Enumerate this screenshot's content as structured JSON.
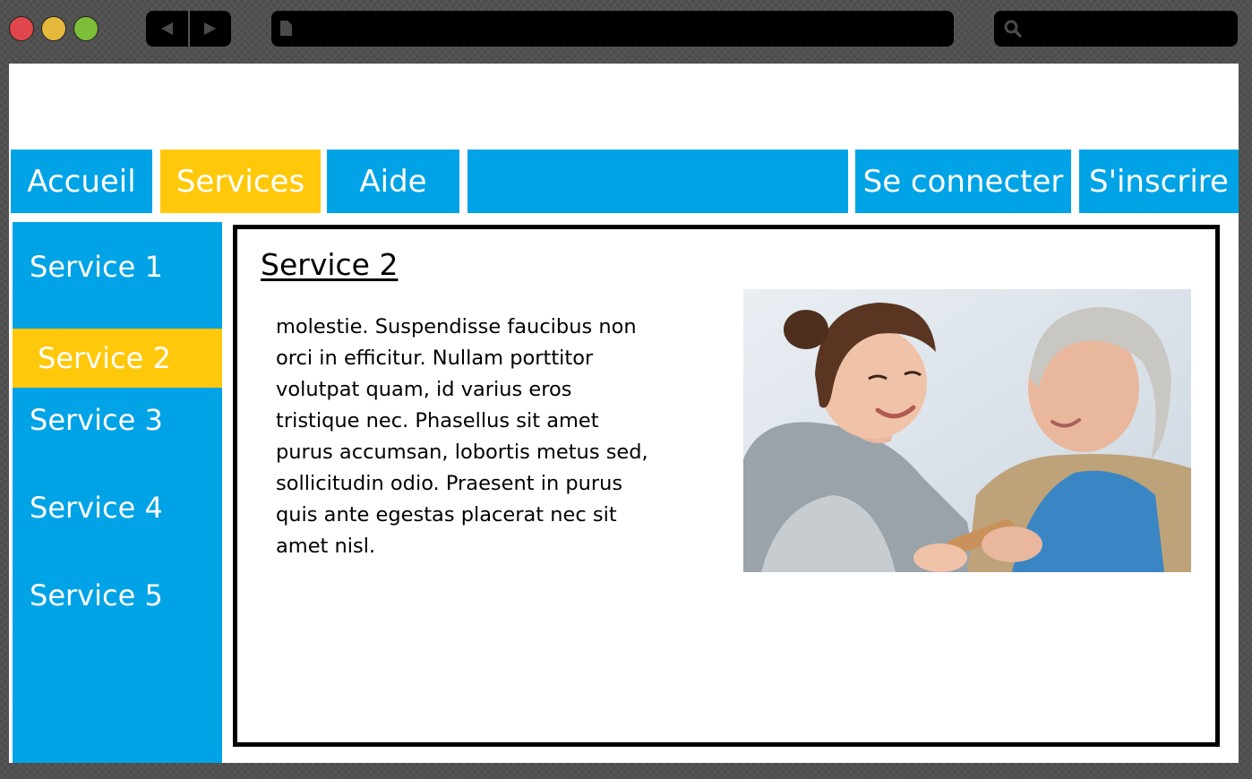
{
  "browser": {
    "url": "",
    "search": ""
  },
  "topnav": {
    "items": [
      {
        "label": "Accueil",
        "active": false
      },
      {
        "label": "Services",
        "active": true
      },
      {
        "label": "Aide",
        "active": false
      },
      {
        "label": "",
        "active": false
      },
      {
        "label": "Se connecter",
        "active": false
      },
      {
        "label": "S'inscrire",
        "active": false
      }
    ]
  },
  "sidebar": {
    "items": [
      {
        "label": "Service 1",
        "active": false
      },
      {
        "label": "Service 2",
        "active": true
      },
      {
        "label": "Service 3",
        "active": false
      },
      {
        "label": "Service 4",
        "active": false
      },
      {
        "label": "Service 5",
        "active": false
      }
    ]
  },
  "content": {
    "title": "Service 2",
    "lines": [
      "molestie. Suspendisse faucibus non",
      "orci in efficitur. Nullam porttitor",
      "volutpat quam, id varius eros",
      "tristique nec. Phasellus sit amet",
      "purus accumsan, lobortis metus sed,",
      "sollicitudin odio. Praesent in purus",
      "quis ante egestas placerat nec sit",
      "amet nisl."
    ],
    "image": "caregiver-with-elderly-woman-photo"
  },
  "colors": {
    "nav_blue": "#00a3e6",
    "active_yellow": "#ffc80b"
  }
}
